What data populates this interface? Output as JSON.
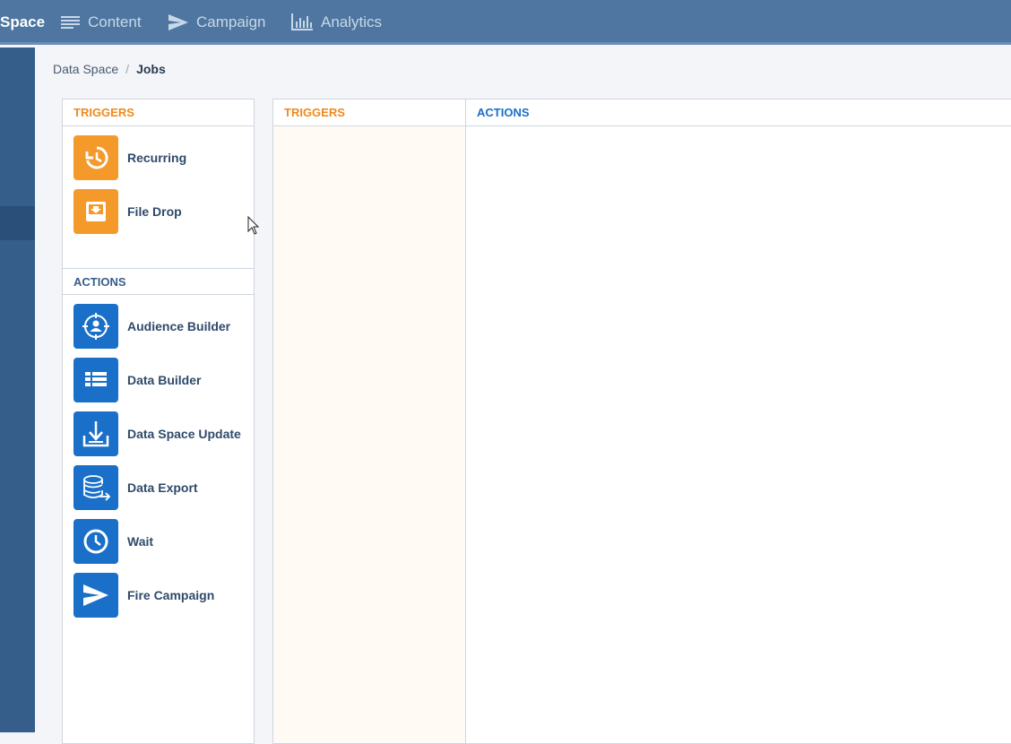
{
  "topnav": {
    "items": [
      {
        "label": "Space",
        "icon": "data-space-icon",
        "active": true
      },
      {
        "label": "Content",
        "icon": "content-lines-icon",
        "active": false
      },
      {
        "label": "Campaign",
        "icon": "send-icon",
        "active": false
      },
      {
        "label": "Analytics",
        "icon": "bar-chart-icon",
        "active": false
      }
    ]
  },
  "breadcrumb": {
    "parent": "Data Space",
    "separator": "/",
    "current": "Jobs"
  },
  "palette": {
    "triggers_header": "TRIGGERS",
    "triggers": [
      {
        "label": "Recurring",
        "icon": "history-icon"
      },
      {
        "label": "File Drop",
        "icon": "inbox-download-icon"
      }
    ],
    "actions_header": "ACTIONS",
    "actions": [
      {
        "label": "Audience Builder",
        "icon": "target-person-icon"
      },
      {
        "label": "Data Builder",
        "icon": "table-icon"
      },
      {
        "label": "Data Space Update",
        "icon": "download-tray-icon"
      },
      {
        "label": "Data Export",
        "icon": "database-export-icon"
      },
      {
        "label": "Wait",
        "icon": "clock-icon"
      },
      {
        "label": "Fire Campaign",
        "icon": "send-icon"
      }
    ]
  },
  "canvas": {
    "triggers_header": "TRIGGERS",
    "actions_header": "ACTIONS"
  },
  "colors": {
    "topbar": "#4e76a0",
    "trigger_orange": "#f39a2b",
    "action_blue": "#1a6fc8"
  }
}
